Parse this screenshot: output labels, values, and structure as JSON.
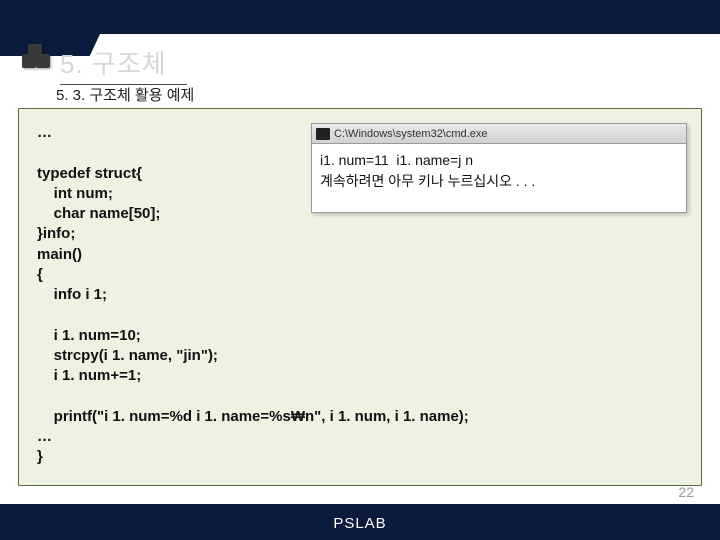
{
  "header": {
    "chapter_title": "5. 구조체",
    "section_title": "5. 3. 구조체 활용 예제"
  },
  "code": {
    "lines": [
      "…",
      "",
      "typedef struct{",
      "    int num;",
      "    char name[50];",
      "}info;",
      "main()",
      "{",
      "    info i 1;",
      "",
      "    i 1. num=10;",
      "    strcpy(i 1. name, \"jin\");",
      "    i 1. num+=1;",
      "",
      "    printf(\"i 1. num=%d i 1. name=%s₩n\", i 1. num, i 1. name);",
      "…",
      "}"
    ]
  },
  "console": {
    "title": "C:\\Windows\\system32\\cmd.exe",
    "lines": [
      "i1. num=11  i1. name=j n",
      "계속하려면 아무 키나 누르십시오 . . ."
    ]
  },
  "footer": {
    "lab": "PSLAB",
    "page": "22"
  }
}
